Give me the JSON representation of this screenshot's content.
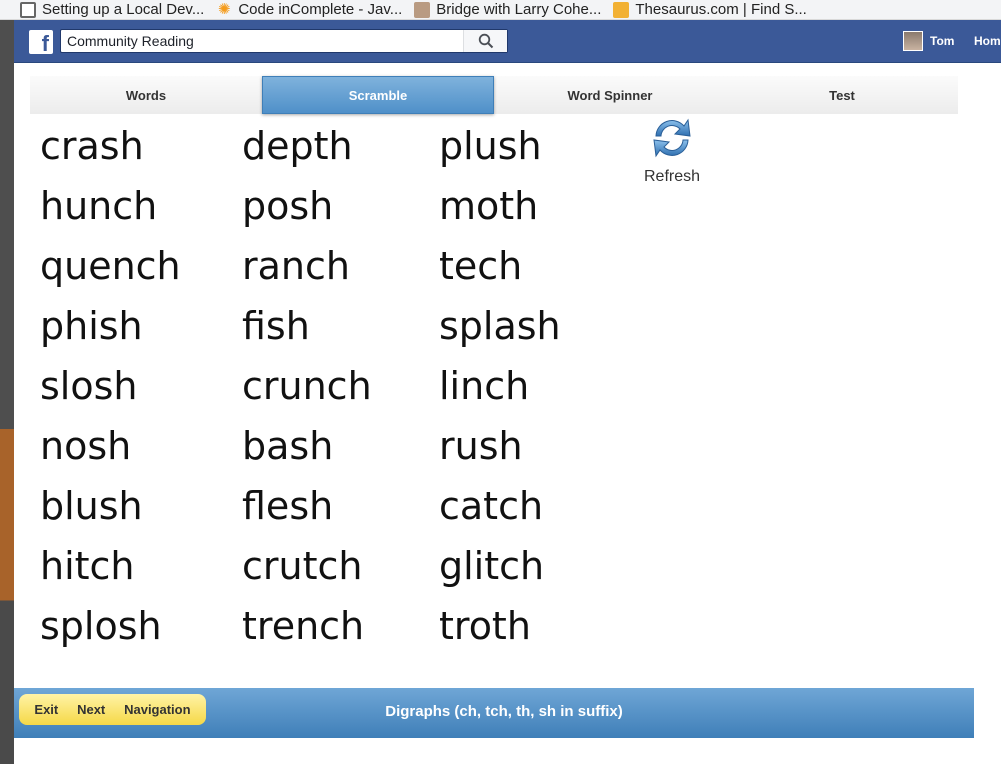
{
  "browser": {
    "bookmarks": [
      {
        "label": "Setting up a Local Dev...",
        "icon": "document-icon"
      },
      {
        "label": "Code inComplete - Jav...",
        "icon": "sun-icon"
      },
      {
        "label": "Bridge with Larry Cohe...",
        "icon": "person-icon"
      },
      {
        "label": "Thesaurus.com | Find S...",
        "icon": "thesaurus-icon"
      }
    ]
  },
  "fb": {
    "search_value": "Community Reading",
    "user_name": "Tom",
    "home_label": "Hom"
  },
  "tabs": [
    {
      "label": "Words",
      "active": false
    },
    {
      "label": "Scramble",
      "active": true
    },
    {
      "label": "Word Spinner",
      "active": false
    },
    {
      "label": "Test",
      "active": false
    }
  ],
  "words": {
    "columns": [
      [
        "crash",
        "hunch",
        "quench",
        "phish",
        "slosh",
        "nosh",
        "blush",
        "hitch",
        "splosh"
      ],
      [
        "depth",
        "posh",
        "ranch",
        "fish",
        "crunch",
        "bash",
        "flesh",
        "crutch",
        "trench"
      ],
      [
        "plush",
        "moth",
        "tech",
        "splash",
        "linch",
        "rush",
        "catch",
        "glitch",
        "troth"
      ]
    ]
  },
  "refresh": {
    "label": "Refresh",
    "icon": "refresh-icon"
  },
  "bottom": {
    "exit_label": "Exit",
    "next_label": "Next",
    "navigation_label": "Navigation",
    "title": "Digraphs (ch, tch, th, sh in suffix)"
  },
  "colors": {
    "facebook_blue": "#3b5998",
    "active_tab": "#5d9bd0",
    "nav_pill": "#f7dd5c"
  }
}
